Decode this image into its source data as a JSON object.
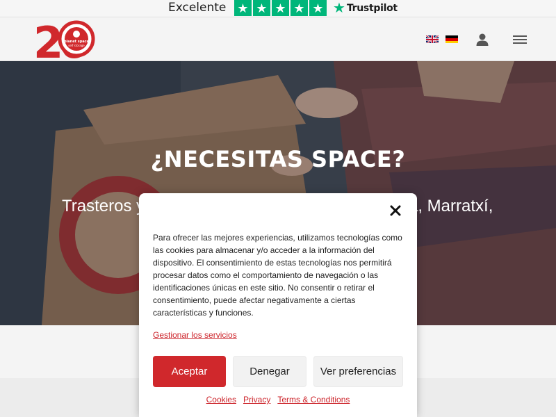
{
  "trustpilot": {
    "rating_label": "Excelente",
    "stars": [
      "★",
      "★",
      "★",
      "★",
      "★"
    ],
    "brand_star": "★",
    "brand_name": "Trustpilot",
    "star_color": "#00b67a"
  },
  "header": {
    "logo": {
      "number": "20",
      "years_label": "años",
      "brand_line1": "planet space",
      "brand_line2": "self storage"
    },
    "languages": [
      {
        "code": "en",
        "icon": "uk-flag-icon"
      },
      {
        "code": "de",
        "icon": "german-flag-icon"
      }
    ],
    "account_icon": "user-icon",
    "menu_icon": "hamburger-menu-icon"
  },
  "hero": {
    "title": "¿NECESITAS SPACE?",
    "subtitle_left": "Trasteros y",
    "subtitle_right": "a, Marratxí,"
  },
  "cookie_banner": {
    "close_icon": "close-icon",
    "text": "Para ofrecer las mejores experiencias, utilizamos tecnologías como las cookies para almacenar y/o acceder a la información del dispositivo. El consentimiento de estas tecnologías nos permitirá procesar datos como el comportamiento de navegación o las identificaciones únicas en este sitio. No consentir o retirar el consentimiento, puede afectar negativamente a ciertas características y funciones.",
    "manage_link": "Gestionar los servicios",
    "buttons": {
      "accept": "Aceptar",
      "deny": "Denegar",
      "preferences": "Ver preferencias"
    },
    "links": [
      "Cookies",
      "Privacy",
      "Terms & Conditions"
    ],
    "accent_color": "#d0282c"
  }
}
